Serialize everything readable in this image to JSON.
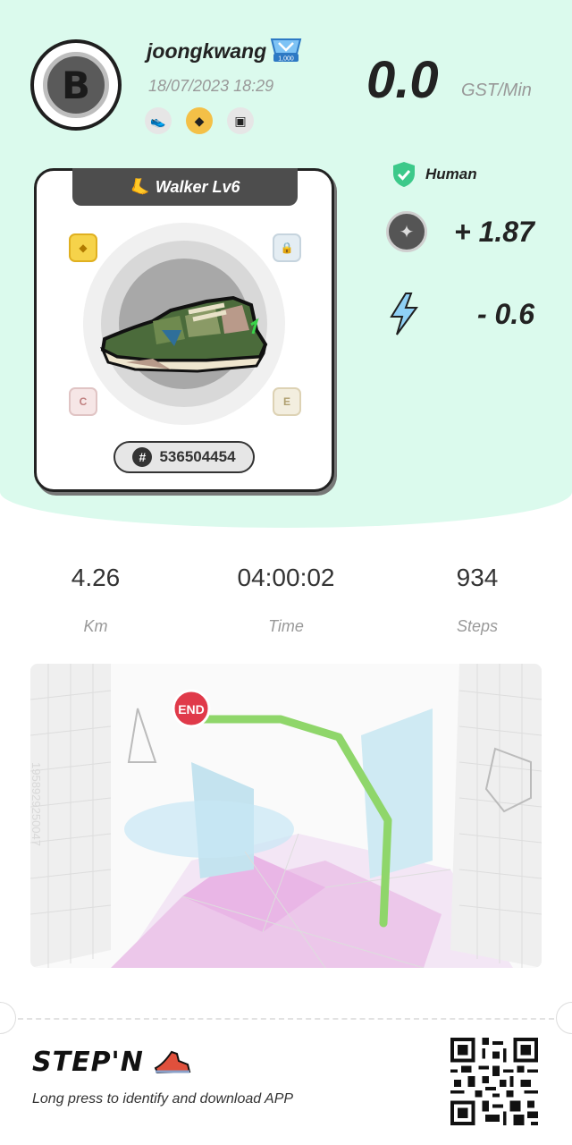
{
  "profile": {
    "username": "joongkwang",
    "badge_text": "1,000",
    "datetime": "18/07/2023 18:29",
    "avatar_symbol": "B",
    "attribute_icons": [
      "sneaker-icon",
      "gem-icon",
      "ticket-icon"
    ]
  },
  "earning": {
    "rate_value": "0.0",
    "rate_unit": "GST/Min"
  },
  "verification": {
    "label": "Human"
  },
  "stats": {
    "gain_value": "+ 1.87",
    "energy_value": "- 0.6"
  },
  "sneaker": {
    "title": "Walker Lv6",
    "id_hash": "#",
    "id": "536504454",
    "slot_letters": [
      "",
      "",
      "C",
      "E"
    ]
  },
  "metrics": {
    "distance_value": "4.26",
    "distance_label": "Km",
    "time_value": "04:00:02",
    "time_label": "Time",
    "steps_value": "934",
    "steps_label": "Steps"
  },
  "map": {
    "end_label": "END",
    "route_color": "#8fd66a",
    "side_text": "1958929250047"
  },
  "footer": {
    "brand": "STEP'N",
    "hint": "Long press to identify and download APP"
  },
  "colors": {
    "top_bg": "#dbfaed",
    "human_green": "#3cc98a",
    "energy_blue": "#8fd0f5"
  }
}
